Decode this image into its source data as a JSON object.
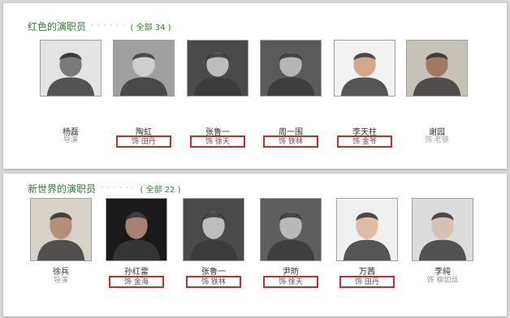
{
  "sections": [
    {
      "title": "红色的演职员",
      "dots": "· · · · · ·",
      "count": "( 全部 34 )",
      "cast": [
        {
          "name": "杨磊",
          "role": "导演",
          "boxed": false,
          "tone": "#7a7a7a",
          "bg": "#e4e4e4"
        },
        {
          "name": "陶虹",
          "role": "饰 田丹",
          "boxed": true,
          "tone": "#cfcfcf",
          "bg": "#a0a0a0"
        },
        {
          "name": "张鲁一",
          "role": "饰 徐天",
          "boxed": true,
          "tone": "#bdbdbd",
          "bg": "#4a4a4a"
        },
        {
          "name": "周一围",
          "role": "饰 铁林",
          "boxed": true,
          "tone": "#b5b5b5",
          "bg": "#5a5a5a"
        },
        {
          "name": "李天柱",
          "role": "饰 金爷",
          "boxed": true,
          "tone": "#d2a98c",
          "bg": "#f2f2f2"
        },
        {
          "name": "谢园",
          "role": "饰 老铁",
          "boxed": false,
          "tone": "#a07a60",
          "bg": "#c7c2b8"
        }
      ]
    },
    {
      "title": "新世界的演职员",
      "dots": "· · · · · ·",
      "count": "( 全部 22 )",
      "cast": [
        {
          "name": "徐兵",
          "role": "导演",
          "boxed": false,
          "tone": "#b58f7a",
          "bg": "#d8d2c8"
        },
        {
          "name": "孙红雷",
          "role": "饰 金海",
          "boxed": true,
          "tone": "#a88270",
          "bg": "#1a1a1a"
        },
        {
          "name": "张鲁一",
          "role": "饰 铁林",
          "boxed": true,
          "tone": "#bdbdbd",
          "bg": "#4a4a4a"
        },
        {
          "name": "尹昉",
          "role": "饰 徐天",
          "boxed": true,
          "tone": "#b9b9b9",
          "bg": "#5e5e5e"
        },
        {
          "name": "万茜",
          "role": "饰 田丹",
          "boxed": true,
          "tone": "#e0bca6",
          "bg": "#f0f0f0"
        },
        {
          "name": "李纯",
          "role": "饰 柳如丝",
          "boxed": false,
          "tone": "#d6c2b4",
          "bg": "#dcdcdc"
        }
      ]
    }
  ]
}
